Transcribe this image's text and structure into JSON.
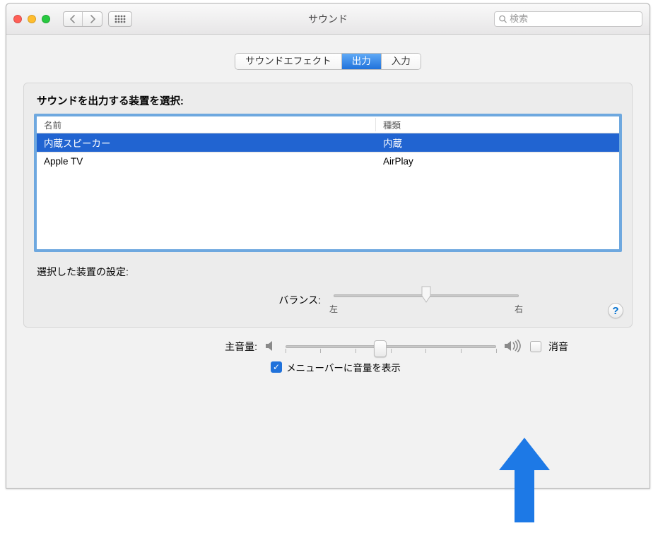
{
  "window_title": "サウンド",
  "search": {
    "placeholder": "検索"
  },
  "tabs": {
    "items": [
      {
        "label": "サウンドエフェクト"
      },
      {
        "label": "出力"
      },
      {
        "label": "入力"
      }
    ],
    "active_index": 1
  },
  "section_title": "サウンドを出力する装置を選択:",
  "columns": {
    "name": "名前",
    "type": "種類"
  },
  "devices": [
    {
      "name": "内蔵スピーカー",
      "type": "内蔵",
      "selected": true
    },
    {
      "name": "Apple TV",
      "type": "AirPlay",
      "selected": false
    }
  ],
  "selected_device_settings_label": "選択した装置の設定:",
  "balance": {
    "label": "バランス:",
    "left": "左",
    "right": "右",
    "value_pct": 50
  },
  "master_volume": {
    "label": "主音量:",
    "value_pct": 45
  },
  "mute": {
    "label": "消音",
    "checked": false
  },
  "menubar": {
    "label": "メニューバーに音量を表示",
    "checked": true
  },
  "help_char": "?"
}
